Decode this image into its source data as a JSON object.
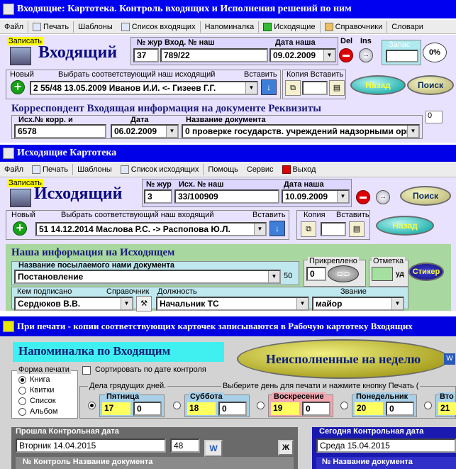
{
  "win1": {
    "title": "Входящие:  Картотека.     Контроль входящих  и  Исполнения решений по ним",
    "menu": [
      "Файл",
      "Печать",
      "Шаблоны",
      "Список входящих",
      "Напоминалка",
      "Исходящие",
      "Справочники",
      "Словари"
    ],
    "save_label": "Записать",
    "heading": "Входящий",
    "num_label": "№ жур",
    "num_value": "37",
    "inno_label": "Вход.  №   наш",
    "inno_value": "789/22",
    "date_label": "Дата наша",
    "date_value": "09.02.2009",
    "del_label": "Del",
    "ins_label": "Ins",
    "reserve_label": "Запас",
    "percent_value": "0%",
    "new_label": "Новый",
    "choose_label": "Выбрать соответствующий наш исходящий",
    "insert_label": "Вставить",
    "outgoing_value": "2 55/48 13.05.2009 Иванов И.И. <- Гизеев Г.Г.",
    "copy_label": "Копия Вставить",
    "back_label": "Назад",
    "search_label": "Поиск",
    "corr_title": "Корреспондент   Входящая информация на документе      Реквизиты",
    "outno_label": "Исх.№ корр.      и",
    "outno_value": "6578",
    "date2_label": "Дата",
    "date2_value": "06.02.2009",
    "docname_label": "Название документа",
    "docname_value": "0 проверке государств. учреждений надзорными орган",
    "counter_value": "0"
  },
  "win2": {
    "title": "Исходящие  Картотека",
    "menu": [
      "Файл",
      "Печать",
      "Шаблоны",
      "Список исходящих",
      "Помощь",
      "Сервис",
      "Выход"
    ],
    "save_label": "Записать",
    "heading": "Исходящий",
    "num_label": "№ жур",
    "num_value": "3",
    "outno_label": "Исх. №  наш",
    "outno_value": "33/100909",
    "date_label": "Дата наша",
    "date_value": "10.09.2009",
    "search_label": "Поиск",
    "new_label": "Новый",
    "choose_label": "Выбрать соответствующий наш входящий",
    "insert_label": "Вставить",
    "incoming_value": "51  14.12.2014 Маслова Р.С. -> Распопова Ю.Л.",
    "copy_label": "Копия",
    "copy_insert_label": "Вставить",
    "back_label": "Назад",
    "info_title": "Наша информация на Исходящем",
    "docname_label": "Название посылаемого нами документа",
    "docname_value": "Постановление",
    "docname_count": "50",
    "attached_label": "Прикреплено",
    "attached_value": "0",
    "mark_label": "Отметка",
    "mark_del": "уд",
    "sticker_label": "Стикер",
    "signed_label": "Кем подписано",
    "ref_label": "Справочник",
    "signed_value": "Сердюков В.В.",
    "position_label": "Должность",
    "position_value": "Начальник ТС",
    "rank_label": "Звание",
    "rank_value": "майор"
  },
  "win3": {
    "title": "При печати - копии соответствующих карточек записываются в Рабочую картотеку Входящих",
    "heading": "Напоминалка  по Входящим",
    "undone_label": "Неисполненные на неделю",
    "print_form_label": "Форма печати",
    "forms": [
      "Книга",
      "Квитки",
      "Список",
      "Альбом"
    ],
    "sort_label": "Сортировать по дате контроля",
    "days_label": "Дела грядущих дней.",
    "choose_day_label": "Выберите день для печати и нажмите кнопку Печать (",
    "days": [
      {
        "name": "Пятница",
        "num": "17",
        "val": "0"
      },
      {
        "name": "Суббота",
        "num": "18",
        "val": "0"
      },
      {
        "name": "Воскресение",
        "num": "19",
        "val": "0"
      },
      {
        "name": "Понедельник",
        "num": "20",
        "val": "0"
      },
      {
        "name": "Вто",
        "num": "21",
        "val": ""
      }
    ],
    "past_label": "Прошла Контрольная дата",
    "past_date": "Вторник 14.04.2015",
    "past_count": "48",
    "col_no": "№",
    "col_control": "Контроль",
    "col_docname": "Название документа",
    "today_label": "Сегодня Контрольная дата",
    "today_date": "Среда 15.04.2015",
    "col_docname2": "Название документа",
    "w_label": "W",
    "zh_label": "Ж"
  }
}
